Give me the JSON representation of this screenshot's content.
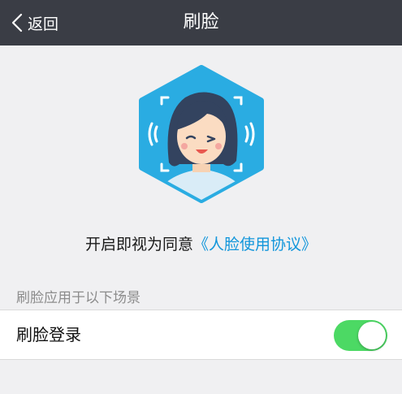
{
  "nav": {
    "back_label": "返回",
    "title": "刷脸"
  },
  "agreement": {
    "prefix": "开启即视为同意",
    "link_text": "《人脸使用协议》"
  },
  "section": {
    "label": "刷脸应用于以下场景"
  },
  "settings": {
    "face_login_label": "刷脸登录",
    "face_login_enabled": true
  },
  "colors": {
    "navbar": "#3a3d45",
    "link": "#1296db",
    "toggle_on": "#4cd964",
    "hex_badge": "#2aace2"
  },
  "icons": {
    "back": "chevron-left-icon",
    "hero": "face-scan-icon"
  }
}
